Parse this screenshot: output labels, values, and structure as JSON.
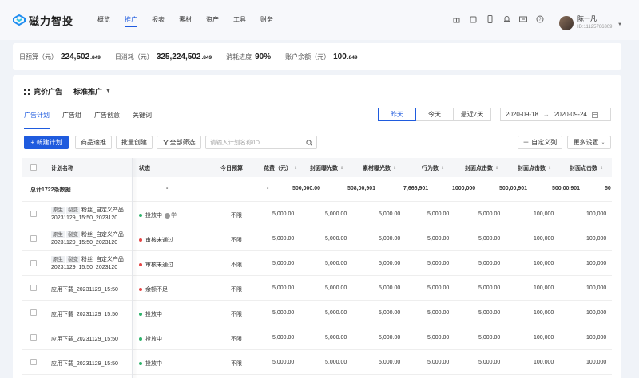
{
  "app": {
    "name": "磁力智投",
    "brand_color": "#1f5bde"
  },
  "nav": [
    "概览",
    "推广",
    "报表",
    "素材",
    "资产",
    "工具",
    "财务"
  ],
  "top_icons": [
    "gift-icon",
    "bookmark-icon",
    "mobile-icon",
    "bell-icon",
    "message-icon",
    "help-icon"
  ],
  "user": {
    "name": "陈一凡",
    "id": "ID:11125766309"
  },
  "stats": [
    {
      "label": "日预算（元）",
      "value": "224,502",
      "small": ".849"
    },
    {
      "label": "日消耗（元）",
      "value": "325,224,502",
      "small": ".849"
    },
    {
      "label": "消耗进度",
      "value": "90%",
      "small": ""
    },
    {
      "label": "账户余额（元）",
      "value": "100",
      "small": ".849"
    }
  ],
  "panel": {
    "title": "竞价广告",
    "dropdown": "标准推广"
  },
  "tabs": [
    "广告计划",
    "广告组",
    "广告创意",
    "关键词"
  ],
  "date_buttons": [
    "昨天",
    "今天",
    "最近7天"
  ],
  "date_range": {
    "start": "2020-09-18",
    "end": "2020-09-24"
  },
  "toolbar": {
    "new_plan": "+ 新建计划",
    "quick": "商品速推",
    "batch": "批量创建",
    "filter": "全部筛选",
    "search_placeholder": "请输入计划名称/ID",
    "custom_cols": "自定义列",
    "more": "更多设置"
  },
  "table": {
    "headers": [
      "计划名称",
      "状态",
      "今日预算",
      "花费（元）",
      "封面曝光数",
      "素材曝光数",
      "行为数",
      "封面点击数",
      "封面点击数",
      "封面点击数"
    ],
    "total": {
      "label": "总计1722条数据",
      "status": "-",
      "spend": "-",
      "c1": "500,000.00",
      "c2": "508,00,901",
      "c3": "7,666,901",
      "c4": "1000,000",
      "c5": "500,00,901",
      "c6": "500,00,901",
      "c7": "50"
    },
    "rows": [
      {
        "tags": [
          "原生",
          "裂变"
        ],
        "name": "粉丝_自定义产品",
        "name2": "20231129_15:50_2023120",
        "status": "投放中",
        "status_color": "#2fb36b",
        "extra": "学",
        "budget": "不限",
        "v": [
          "5,000.00",
          "5,000.00",
          "5,000.00",
          "5,000.00",
          "5,000.00",
          "100,000",
          "100,000"
        ]
      },
      {
        "tags": [
          "原生",
          "裂变"
        ],
        "name": "粉丝_自定义产品",
        "name2": "20231129_15:50_2023120",
        "status": "审核未通过",
        "status_color": "#e54545",
        "extra": "",
        "budget": "不限",
        "v": [
          "5,000.00",
          "5,000.00",
          "5,000.00",
          "5,000.00",
          "5,000.00",
          "100,000",
          "100,000"
        ]
      },
      {
        "tags": [
          "原生",
          "裂变"
        ],
        "name": "粉丝_自定义产品",
        "name2": "20231129_15:50_2023120",
        "status": "审核未通过",
        "status_color": "#e54545",
        "extra": "",
        "budget": "不限",
        "v": [
          "5,000.00",
          "5,000.00",
          "5,000.00",
          "5,000.00",
          "5,000.00",
          "100,000",
          "100,000"
        ]
      },
      {
        "tags": [],
        "name": "应用下载_20231129_15:50",
        "name2": "",
        "status": "余额不足",
        "status_color": "#e54545",
        "extra": "",
        "budget": "不限",
        "v": [
          "5,000.00",
          "5,000.00",
          "5,000.00",
          "5,000.00",
          "5,000.00",
          "100,000",
          "100,000"
        ]
      },
      {
        "tags": [],
        "name": "应用下载_20231129_15:50",
        "name2": "",
        "status": "投放中",
        "status_color": "#2fb36b",
        "extra": "",
        "budget": "不限",
        "v": [
          "5,000.00",
          "5,000.00",
          "5,000.00",
          "5,000.00",
          "5,000.00",
          "100,000",
          "100,000"
        ]
      },
      {
        "tags": [],
        "name": "应用下载_20231129_15:50",
        "name2": "",
        "status": "投放中",
        "status_color": "#2fb36b",
        "extra": "",
        "budget": "不限",
        "v": [
          "5,000.00",
          "5,000.00",
          "5,000.00",
          "5,000.00",
          "5,000.00",
          "100,000",
          "100,000"
        ]
      },
      {
        "tags": [],
        "name": "应用下载_20231129_15:50",
        "name2": "",
        "status": "投放中",
        "status_color": "#2fb36b",
        "extra": "",
        "budget": "不限",
        "v": [
          "5,000.00",
          "5,000.00",
          "5,000.00",
          "5,000.00",
          "5,000.00",
          "100,000",
          "100,000"
        ]
      }
    ]
  }
}
